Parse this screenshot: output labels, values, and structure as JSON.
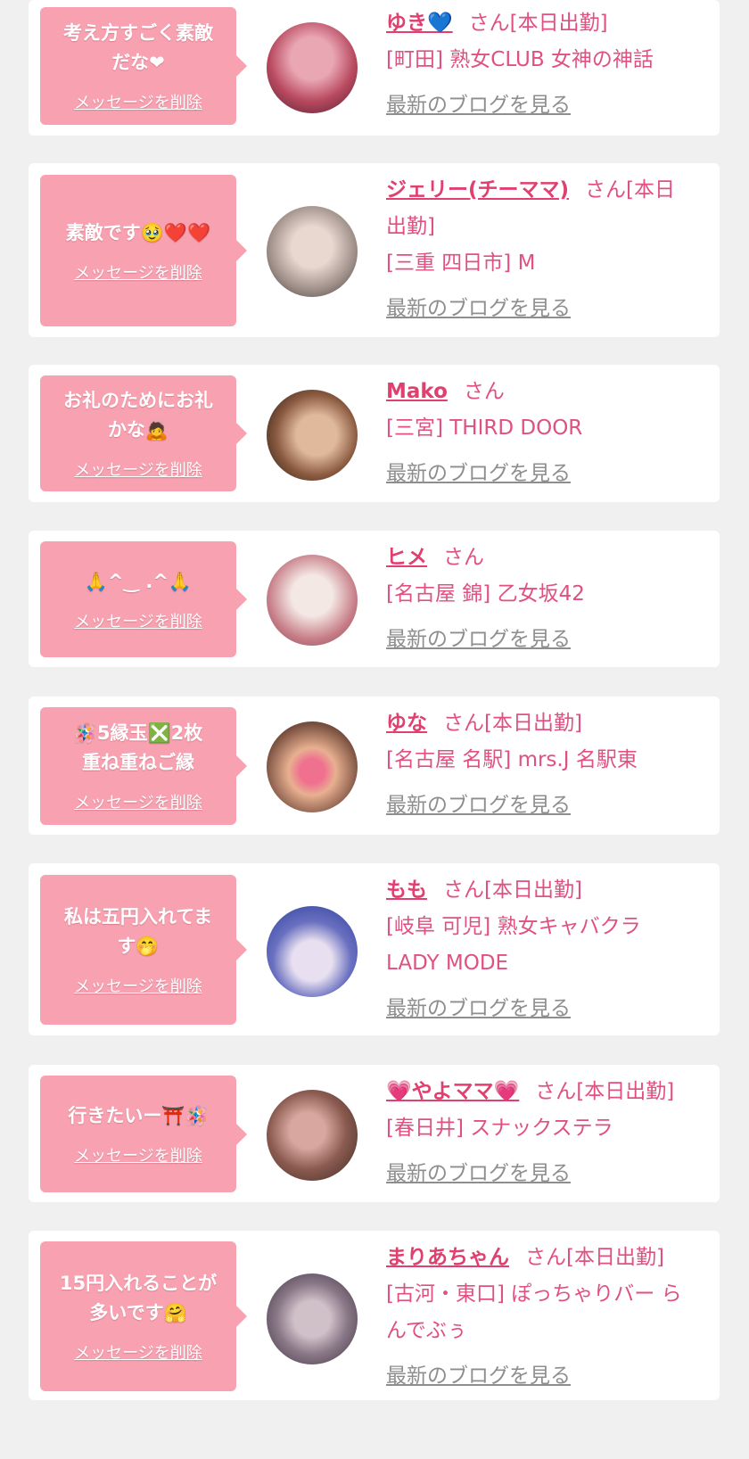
{
  "delete_label": "メッセージを削除",
  "blog_label": "最新のブログを見る",
  "cards": [
    {
      "msg_lines": [
        "考え方すごく素敵",
        "だな❤"
      ],
      "name": "ゆき💙",
      "suffix": "さん[本日出勤]",
      "shop_lines": [
        "[町田] 熟女CLUB 女神の神話"
      ],
      "avatar_colors": [
        "#b8495f",
        "#e9a6b3"
      ]
    },
    {
      "msg_lines": [
        "素敵です🥹❤️❤️"
      ],
      "name": "ジェリー(チーママ)",
      "suffix": "さん[本日",
      "suffix2": "出勤]",
      "shop_lines": [
        "[三重 四日市] M"
      ],
      "avatar_colors": [
        "#9c8c86",
        "#e8d8d0"
      ]
    },
    {
      "msg_lines": [
        "お礼のためにお礼",
        "かな🙇"
      ],
      "name": "Mako",
      "suffix": "さん",
      "shop_lines": [
        "[三宮] THIRD DOOR"
      ],
      "avatar_colors": [
        "#1c1410",
        "#e0b89c"
      ]
    },
    {
      "msg_lines": [
        "🙏^‿ .^🙏"
      ],
      "name": "ヒメ",
      "suffix": "さん",
      "shop_lines": [
        "[名古屋 錦] 乙女坂42"
      ],
      "avatar_colors": [
        "#c67c86",
        "#f4e8e4"
      ]
    },
    {
      "msg_lines": [
        "🪅5縁玉❎2枚",
        "重ね重ねご縁"
      ],
      "name": "ゆな",
      "suffix": "さん[本日出勤]",
      "shop_lines": [
        "[名古屋 名駅] mrs.J 名駅東"
      ],
      "avatar_colors": [
        "#7a5040",
        "#e8b090"
      ]
    },
    {
      "msg_lines": [
        "私は五円入れてま",
        "す🤭"
      ],
      "name": "もも",
      "suffix": "さん[本日出勤]",
      "shop_lines": [
        "[岐阜 可児] 熟女キャバクラ",
        "LADY MODE"
      ],
      "avatar_colors": [
        "#2a3e9c",
        "#e8e0f0"
      ]
    },
    {
      "msg_lines": [
        "行きたいー⛩️🪅"
      ],
      "name": "💗やよママ💗",
      "suffix": "さん[本日出勤]",
      "shop_lines": [
        "[春日井] スナックステラ"
      ],
      "avatar_colors": [
        "#3a2a20",
        "#d8a8a0"
      ]
    },
    {
      "msg_lines": [
        "15円入れることが",
        "多いです🤗"
      ],
      "name": "まりあちゃん",
      "suffix": "さん[本日出勤]",
      "shop_lines": [
        "[古河・東口] ぽっちゃりバー ら",
        "んでぶぅ"
      ],
      "avatar_colors": [
        "#5a5060",
        "#d0c0c8"
      ]
    }
  ]
}
